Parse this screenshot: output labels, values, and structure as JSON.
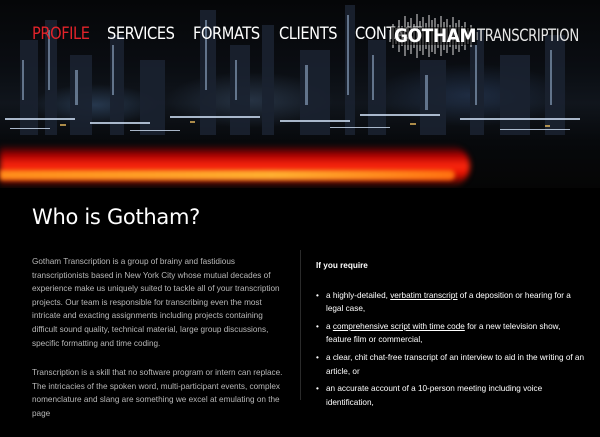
{
  "nav": {
    "items": [
      {
        "label": "PROFILE",
        "active": true
      },
      {
        "label": "SERVICES",
        "active": false
      },
      {
        "label": "FORMATS",
        "active": false
      },
      {
        "label": "CLIENTS",
        "active": false
      },
      {
        "label": "CONTACT",
        "active": false
      }
    ]
  },
  "logo": {
    "bold": "GOTHAM",
    "light": "TRANSCRIPTION"
  },
  "page_title": "Who is Gotham?",
  "intro": {
    "paragraphs": [
      "Gotham Transcription is a group of brainy and fastidious transcriptionists based in New York City whose mutual decades of experience make us uniquely suited to tackle all of your transcription projects. Our team is responsible for transcribing even the most intricate and exacting assignments including projects containing difficult sound quality, technical material, large group discussions, specific formatting and time coding.",
      "Transcription is a skill that no software program or intern can replace. The intricacies of the spoken word, multi-participant events, complex nomenclature and slang are something we excel at emulating on the page"
    ]
  },
  "requirements": {
    "heading": "If you require",
    "items": [
      {
        "before": "a highly-detailed, ",
        "link": "verbatim transcript",
        "after": " of a deposition or hearing for a legal case,"
      },
      {
        "before": "a ",
        "link": "comprehensive script with time code",
        "after": " for a new television show, feature film or commercial,"
      },
      {
        "before": "a clear, chit chat-free transcript of an interview to aid in the writing of an article, or",
        "link": "",
        "after": ""
      },
      {
        "before": "an accurate account of a 10-person meeting including voice identification,",
        "link": "",
        "after": ""
      }
    ]
  },
  "colors": {
    "accent": "#e2232a",
    "background": "#000000"
  }
}
